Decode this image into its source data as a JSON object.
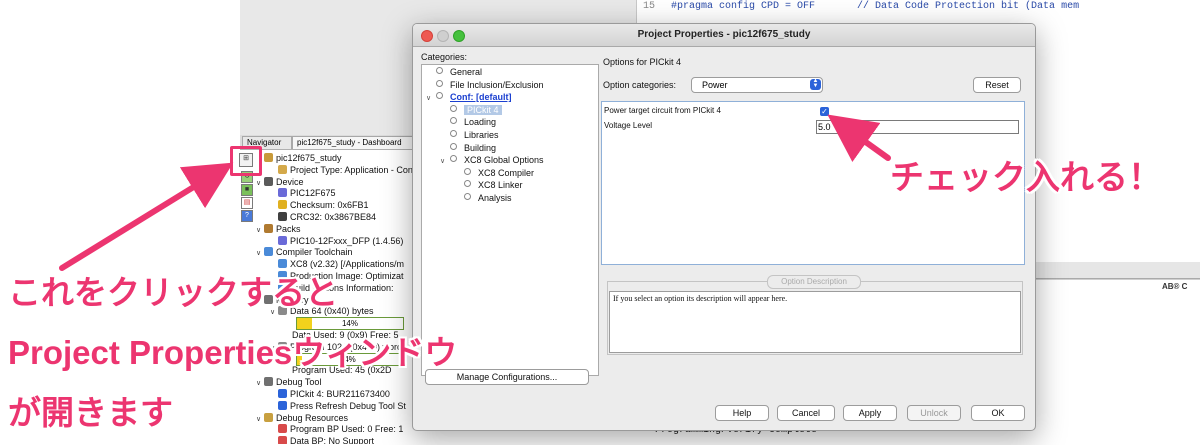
{
  "editor": {
    "line_number": "15",
    "code": "#pragma config CPD = OFF       // Data Code Protection bit (Data mem",
    "output_line": "Programming/Verify complete",
    "clipped_tag": "AB® C"
  },
  "navigator": {
    "tabs": [
      "Navigator",
      "pic12f675_study - Dashboard"
    ],
    "toolbar_icons": [
      "project-properties-icon",
      "refresh-icon",
      "chip-icon",
      "document-icon",
      "help-icon"
    ],
    "rows": [
      {
        "text": "pic12f675_study",
        "indent": 0,
        "toggle": "",
        "icon": "#c89a3a"
      },
      {
        "text": "Project Type: Application - Con",
        "indent": 1,
        "toggle": "",
        "icon": "#d4a94a"
      },
      {
        "text": "Device",
        "indent": 0,
        "toggle": "∨",
        "icon": "#5a5a5a"
      },
      {
        "text": "PIC12F675",
        "indent": 1,
        "toggle": "",
        "icon": "#6a6ad8"
      },
      {
        "text": "Checksum: 0x6FB1",
        "indent": 1,
        "toggle": "",
        "icon": "#e0b020"
      },
      {
        "text": "CRC32: 0x3867BE84",
        "indent": 1,
        "toggle": "",
        "icon": "#404040"
      },
      {
        "text": "Packs",
        "indent": 0,
        "toggle": "∨",
        "icon": "#b07a30"
      },
      {
        "text": "PIC10-12Fxxx_DFP (1.4.56)",
        "indent": 1,
        "toggle": "",
        "icon": "#6a6ad8"
      },
      {
        "text": "Compiler Toolchain",
        "indent": 0,
        "toggle": "∨",
        "icon": "#4a8ad8"
      },
      {
        "text": "XC8 (v2.32) [/Applications/m",
        "indent": 1,
        "toggle": "",
        "icon": "#4a8ad8"
      },
      {
        "text": "Production Image: Optimizat",
        "indent": 1,
        "toggle": "",
        "icon": "#4a8ad8"
      },
      {
        "text": "Build Options Information:",
        "indent": 1,
        "toggle": "",
        "icon": "#4a8ad8"
      },
      {
        "text": "Memory",
        "indent": 0,
        "toggle": "∨",
        "icon": "#707070"
      },
      {
        "text": "Data 64 (0x40) bytes",
        "indent": 1,
        "toggle": "∨",
        "icon": "#8a8a8a"
      },
      {
        "text": "",
        "indent": 2,
        "toggle": "",
        "icon": ""
      },
      {
        "text": "Data Used: 9 (0x9) Free: 5",
        "indent": 2,
        "toggle": "",
        "icon": ""
      },
      {
        "text": "Program 1024 (0x400) words",
        "indent": 1,
        "toggle": "∨",
        "icon": "#8a8a8a"
      },
      {
        "text": "",
        "indent": 2,
        "toggle": "",
        "icon": ""
      },
      {
        "text": "Program Used: 45 (0x2D",
        "indent": 2,
        "toggle": "",
        "icon": ""
      },
      {
        "text": "Debug Tool",
        "indent": 0,
        "toggle": "∨",
        "icon": "#707070"
      },
      {
        "text": "PICkit 4: BUR211673400",
        "indent": 1,
        "toggle": "",
        "icon": "#2b63d9"
      },
      {
        "text": "Press Refresh Debug Tool St",
        "indent": 1,
        "toggle": "",
        "icon": "#2b63d9"
      },
      {
        "text": "Debug Resources",
        "indent": 0,
        "toggle": "∨",
        "icon": "#c8a040"
      },
      {
        "text": "Program BP Used: 0  Free: 1",
        "indent": 1,
        "toggle": "",
        "icon": "#d84a4a"
      },
      {
        "text": "Data BP: No Support",
        "indent": 1,
        "toggle": "",
        "icon": "#d84a4a"
      }
    ],
    "data_bar_label": "14%",
    "program_bar_label": "4%"
  },
  "dialog": {
    "title": "Project Properties - pic12f675_study",
    "categories_label": "Categories:",
    "categories": [
      {
        "label": "General",
        "level": 1,
        "toggle": "",
        "selected": false,
        "link": false
      },
      {
        "label": "File Inclusion/Exclusion",
        "level": 1,
        "toggle": "",
        "selected": false,
        "link": false
      },
      {
        "label": "Conf: [default]",
        "level": 1,
        "toggle": "∨",
        "selected": false,
        "link": true
      },
      {
        "label": "PICkit 4",
        "level": 2,
        "toggle": "",
        "selected": true,
        "link": false
      },
      {
        "label": "Loading",
        "level": 2,
        "toggle": "",
        "selected": false,
        "link": false
      },
      {
        "label": "Libraries",
        "level": 2,
        "toggle": "",
        "selected": false,
        "link": false
      },
      {
        "label": "Building",
        "level": 2,
        "toggle": "",
        "selected": false,
        "link": false
      },
      {
        "label": "XC8 Global Options",
        "level": 2,
        "toggle": "∨",
        "selected": false,
        "link": false
      },
      {
        "label": "XC8 Compiler",
        "level": 3,
        "toggle": "",
        "selected": false,
        "link": false
      },
      {
        "label": "XC8 Linker",
        "level": 3,
        "toggle": "",
        "selected": false,
        "link": false
      },
      {
        "label": "Analysis",
        "level": 3,
        "toggle": "",
        "selected": false,
        "link": false
      }
    ],
    "manage_button": "Manage Configurations...",
    "options_for": "Options for PICkit 4",
    "option_categories_label": "Option categories:",
    "option_categories_value": "Power",
    "reset_button": "Reset",
    "props": {
      "power_label": "Power target circuit from PICkit 4",
      "power_checked": true,
      "voltage_label": "Voltage Level",
      "voltage_value": "5.0"
    },
    "description_legend": "Option Description",
    "description_text": "If you select an option its description will appear here.",
    "buttons": {
      "help": "Help",
      "cancel": "Cancel",
      "apply": "Apply",
      "unlock": "Unlock",
      "ok": "OK"
    }
  },
  "annotations": {
    "right_note": "チェック入れる！",
    "left_note_1": "これをクリックすると",
    "left_note_2": "Project Propertiesウィンドウ",
    "left_note_3": "が開きます",
    "color": "#ec3570"
  }
}
